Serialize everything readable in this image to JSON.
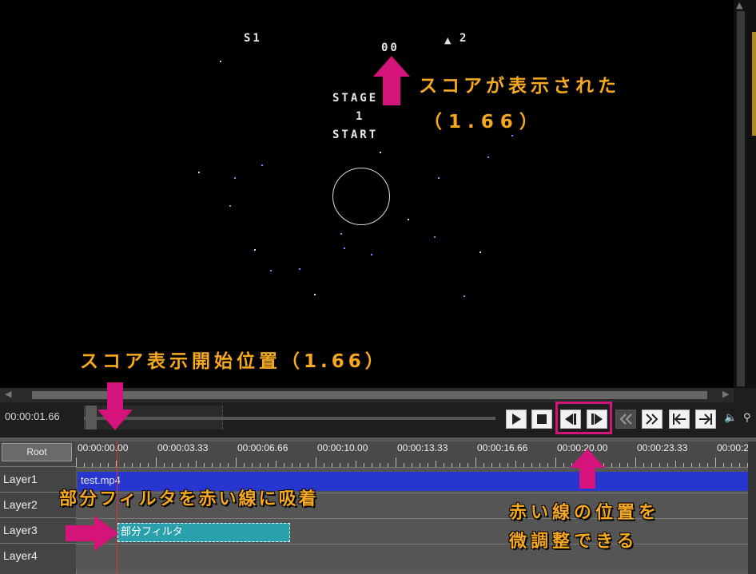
{
  "game": {
    "player_label": "S1",
    "score": "00",
    "lives": "2",
    "stage_word": "STAGE",
    "stage_number": "1",
    "start_word": "START"
  },
  "annotations": {
    "score_shown": "スコアが表示された",
    "score_shown_time": "（1.66）",
    "score_start_position": "スコア表示開始位置（1.66）",
    "snap_filter": "部分フィルタを赤い線に吸着",
    "fine_adjust_line1": "赤い線の位置を",
    "fine_adjust_line2": "微調整できる"
  },
  "transport": {
    "current_time": "00:00:01.66",
    "buttons": [
      "play",
      "stop",
      "prev-frame",
      "next-frame",
      "rewind",
      "fast-forward",
      "jump-start",
      "jump-end"
    ]
  },
  "timeline": {
    "root_label": "Root",
    "ruler_labels": [
      "00:00:00.00",
      "00:00:03.33",
      "00:00:06.66",
      "00:00:10.00",
      "00:00:13.33",
      "00:00:16.66",
      "00:00:20.00",
      "00:00:23.33",
      "00:00:2"
    ],
    "layers": [
      "Layer1",
      "Layer2",
      "Layer3",
      "Layer4"
    ],
    "video_clip": "test.mp4",
    "filter_clip": "部分フィルタ"
  },
  "colors": {
    "annotation": "#f6a81e",
    "arrow": "#d4147a",
    "playhead": "#e0303a",
    "video_clip": "#2836d0",
    "filter_clip": "#2aa0ad"
  }
}
